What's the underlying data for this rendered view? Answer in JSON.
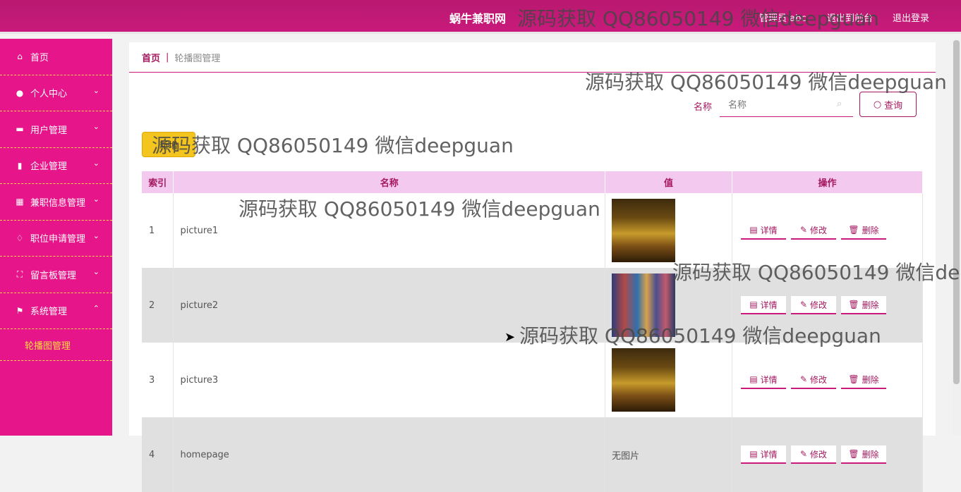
{
  "header": {
    "site_name": "蜗牛兼职网",
    "admin_label": "管理员 abc",
    "back_label": "退出到前台",
    "logout_label": "退出登录"
  },
  "sidebar": {
    "items": [
      {
        "label": "首页",
        "icon": "home-icon"
      },
      {
        "label": "个人中心",
        "icon": "user-icon"
      },
      {
        "label": "用户管理",
        "icon": "briefcase-icon"
      },
      {
        "label": "企业管理",
        "icon": "building-icon"
      },
      {
        "label": "兼职信息管理",
        "icon": "grid-icon"
      },
      {
        "label": "职位申请管理",
        "icon": "bell-icon"
      },
      {
        "label": "留言板管理",
        "icon": "frame-icon"
      },
      {
        "label": "系统管理",
        "icon": "flag-icon"
      }
    ],
    "active_sub": "轮播图管理"
  },
  "breadcrumb": {
    "home": "首页",
    "separator": "|",
    "current": "轮播图管理"
  },
  "search": {
    "label": "名称",
    "placeholder": "名称",
    "button_label": "查询"
  },
  "actions": {
    "add_label": "新增"
  },
  "table": {
    "headers": [
      "索引",
      "名称",
      "值",
      "操作"
    ],
    "rows": [
      {
        "index": "1",
        "name": "picture1",
        "value": "",
        "image": "dark"
      },
      {
        "index": "2",
        "name": "picture2",
        "value": "",
        "image": "color"
      },
      {
        "index": "3",
        "name": "picture3",
        "value": "",
        "image": "dark"
      },
      {
        "index": "4",
        "name": "homepage",
        "value": "无图片",
        "image": ""
      }
    ],
    "op_labels": {
      "detail": "详情",
      "edit": "修改",
      "delete": "删除"
    }
  },
  "watermark_text": "源码获取 QQ86050149 微信deepguan",
  "colors": {
    "primary": "#c91a7c",
    "sidebar": "#e6158a",
    "accent_yellow": "#f5c51f",
    "header_row": "#f3c9f0"
  }
}
